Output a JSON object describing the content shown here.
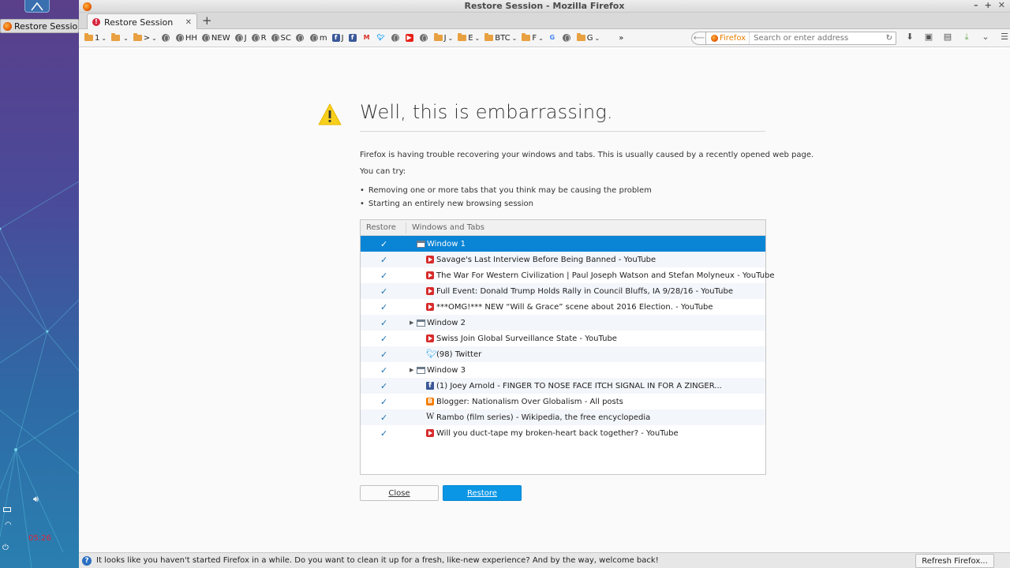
{
  "desktop": {
    "taskbar_entry": "Restore Sessio...",
    "clock": "05:26"
  },
  "window": {
    "title": "Restore Session - Mozilla Firefox",
    "controls": [
      "–",
      "+",
      "✕"
    ]
  },
  "tab": {
    "label": "Restore Session",
    "new_tab": "+"
  },
  "bookmarks": [
    {
      "type": "folder",
      "label": "1",
      "chev": true
    },
    {
      "type": "folder",
      "label": "",
      "chev": true
    },
    {
      "type": "folder",
      "label": ">",
      "chev": true
    },
    {
      "type": "globe",
      "label": ""
    },
    {
      "type": "globe",
      "label": "HH"
    },
    {
      "type": "globe",
      "label": "NEW"
    },
    {
      "type": "globe",
      "label": "J"
    },
    {
      "type": "globe",
      "label": "R"
    },
    {
      "type": "globe",
      "label": "SC"
    },
    {
      "type": "globe",
      "label": ""
    },
    {
      "type": "globe",
      "label": "m"
    },
    {
      "type": "facebook",
      "label": "J"
    },
    {
      "type": "facebook",
      "label": ""
    },
    {
      "type": "gmail",
      "label": ""
    },
    {
      "type": "twitter",
      "label": ""
    },
    {
      "type": "globe",
      "label": ""
    },
    {
      "type": "youtube",
      "label": ""
    },
    {
      "type": "globe",
      "label": ""
    },
    {
      "type": "folder",
      "label": "J",
      "chev": true
    },
    {
      "type": "folder",
      "label": "E",
      "chev": true
    },
    {
      "type": "folder",
      "label": "BTC",
      "chev": true
    },
    {
      "type": "folder",
      "label": "F",
      "chev": true
    },
    {
      "type": "google",
      "label": ""
    },
    {
      "type": "globe",
      "label": ""
    },
    {
      "type": "folder",
      "label": "G",
      "chev": true
    },
    {
      "type": "overflow",
      "label": "»"
    }
  ],
  "urlbar": {
    "identity": "Firefox",
    "placeholder": "Search or enter address"
  },
  "error_page": {
    "title": "Well, this is embarrassing.",
    "description": "Firefox is having trouble recovering your windows and tabs. This is usually caused by a recently opened web page.",
    "try_label": "You can try:",
    "suggestions": [
      "Removing one or more tabs that you think may be causing the problem",
      "Starting an entirely new browsing session"
    ],
    "tree": {
      "col_restore": "Restore",
      "col_windows": "Windows and Tabs",
      "rows": [
        {
          "kind": "window",
          "label": "Window 1",
          "twisty": false,
          "selected": true
        },
        {
          "kind": "tab",
          "icon": "youtube",
          "label": "Savage's Last Interview Before Being Banned - YouTube"
        },
        {
          "kind": "tab",
          "icon": "youtube",
          "label": "The War For Western Civilization | Paul Joseph Watson and Stefan Molyneux - YouTube"
        },
        {
          "kind": "tab",
          "icon": "youtube",
          "label": "Full Event: Donald Trump Holds Rally in Council Bluffs, IA 9/28/16 - YouTube"
        },
        {
          "kind": "tab",
          "icon": "youtube",
          "label": "***OMG!*** NEW “Will & Grace” scene about 2016 Election. - YouTube"
        },
        {
          "kind": "window",
          "label": "Window 2",
          "twisty": true
        },
        {
          "kind": "tab",
          "icon": "youtube",
          "label": "Swiss Join Global Surveillance State - YouTube"
        },
        {
          "kind": "tab",
          "icon": "twitter",
          "label": "(98) Twitter"
        },
        {
          "kind": "window",
          "label": "Window 3",
          "twisty": true
        },
        {
          "kind": "tab",
          "icon": "facebook",
          "label": "(1) Joey Arnold - FINGER TO NOSE FACE ITCH SIGNAL IN FOR A ZINGER..."
        },
        {
          "kind": "tab",
          "icon": "blogger",
          "label": "Blogger: Nationalism Over Globalism - All posts"
        },
        {
          "kind": "tab",
          "icon": "wikipedia",
          "label": "Rambo (film series) - Wikipedia, the free encyclopedia"
        },
        {
          "kind": "tab",
          "icon": "youtube",
          "label": "Will you duct-tape my broken-heart back together? - YouTube"
        }
      ]
    },
    "close_label": "Close",
    "restore_label": "Restore"
  },
  "notification": {
    "text": "It looks like you haven't started Firefox in a while. Do you want to clean it up for a fresh, like-new experience? And by the way, welcome back!",
    "button": "Refresh Firefox..."
  },
  "colors": {
    "accent": "#0a96e5",
    "selected_row": "#0a84d5",
    "warning": "#f7cf1d"
  }
}
